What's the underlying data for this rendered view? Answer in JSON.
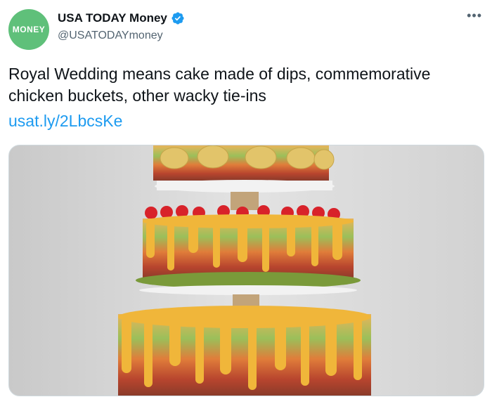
{
  "account": {
    "avatar_text": "MONEY",
    "avatar_color": "#5fc07a",
    "display_name": "USA TODAY Money",
    "handle": "@USATODAYmoney",
    "verified": true,
    "verified_color": "#1d9bf0",
    "more_icon": "more-horizontal-icon"
  },
  "tweet": {
    "text": "Royal Wedding means cake made of dips, commemorative chicken buckets, other wacky tie-ins",
    "link": "usat.ly/2LbcsKe",
    "link_color": "#1d9bf0"
  },
  "media": {
    "image_name": "tiered-dip-cake-photo"
  }
}
